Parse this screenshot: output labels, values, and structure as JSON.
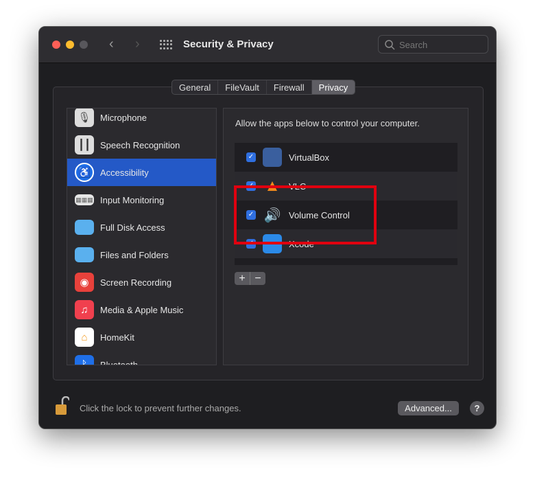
{
  "window": {
    "title": "Security & Privacy",
    "search_placeholder": "Search"
  },
  "tabs": [
    {
      "label": "General"
    },
    {
      "label": "FileVault"
    },
    {
      "label": "Firewall"
    },
    {
      "label": "Privacy",
      "selected": true
    }
  ],
  "sidebar": {
    "items": [
      {
        "label": "Microphone",
        "icon": "microphone-icon"
      },
      {
        "label": "Speech Recognition",
        "icon": "waveform-icon"
      },
      {
        "label": "Accessibility",
        "icon": "accessibility-icon",
        "selected": true
      },
      {
        "label": "Input Monitoring",
        "icon": "keyboard-icon"
      },
      {
        "label": "Full Disk Access",
        "icon": "folder-icon"
      },
      {
        "label": "Files and Folders",
        "icon": "folder-icon"
      },
      {
        "label": "Screen Recording",
        "icon": "record-icon"
      },
      {
        "label": "Media & Apple Music",
        "icon": "music-icon"
      },
      {
        "label": "HomeKit",
        "icon": "home-icon"
      },
      {
        "label": "Bluetooth",
        "icon": "bluetooth-icon"
      }
    ]
  },
  "pane": {
    "header": "Allow the apps below to control your computer.",
    "apps": [
      {
        "name": "VirtualBox",
        "checked": true
      },
      {
        "name": "VLC",
        "checked": true
      },
      {
        "name": "Volume Control",
        "checked": true
      },
      {
        "name": "Xcode",
        "checked": true
      }
    ],
    "add": "+",
    "remove": "−"
  },
  "footer": {
    "lock_text": "Click the lock to prevent further changes.",
    "advanced": "Advanced...",
    "help": "?"
  },
  "colors": {
    "accent": "#2459c7",
    "highlight": "#e0000f"
  }
}
